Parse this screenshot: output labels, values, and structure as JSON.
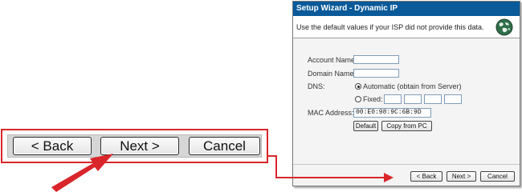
{
  "zoomed_buttons": {
    "back": "< Back",
    "next": "Next >",
    "cancel": "Cancel"
  },
  "dialog": {
    "title": "Setup Wizard - Dynamic IP",
    "instructions": "Use the default values if your ISP did not provide this data.",
    "header_icon": "globe-icon",
    "account_name_label": "Account Name:",
    "account_name_value": "",
    "domain_name_label": "Domain Name:",
    "domain_name_value": "",
    "dns_label": "DNS:",
    "dns_automatic_label": "Automatic (obtain from Server)",
    "dns_fixed_label": "Fixed:",
    "dns_selected": "Automatic (obtain from Server)",
    "mac_label": "MAC Address:",
    "mac_value": "00:E0:98:9C:6B:9D",
    "default_button": "Default",
    "copy_button": "Copy from PC",
    "back_button": "< Back",
    "next_button": "Next >",
    "cancel_button": "Cancel"
  },
  "colors": {
    "highlight": "#d9262b",
    "title_bar": "#0a5a9a"
  }
}
